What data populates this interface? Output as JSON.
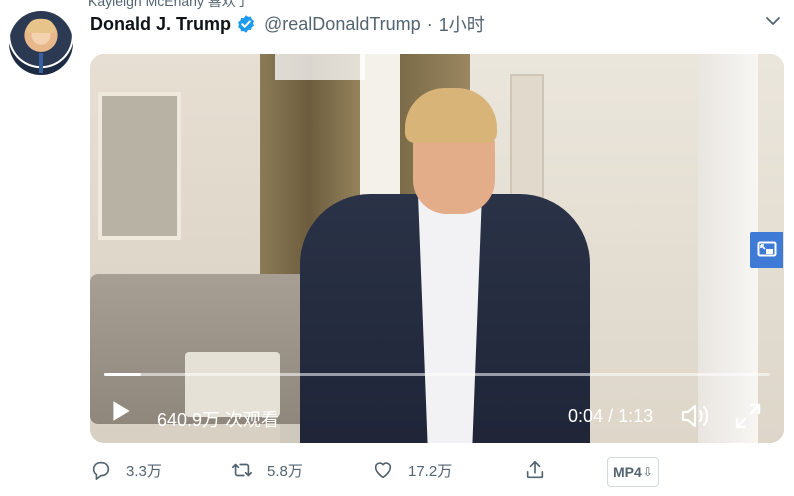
{
  "retweet_context": "Kayleigh McEnany 喜欢了",
  "tweet": {
    "author_name": "Donald J. Trump",
    "handle": "@realDonaldTrump",
    "separator": "·",
    "timestamp": "1小时",
    "verified": true
  },
  "video": {
    "views": "640.9万 次观看",
    "current_time": "0:04",
    "time_separator": "/",
    "duration": "1:13",
    "progress_fraction": 0.055
  },
  "actions": {
    "replies": "3.3万",
    "retweets": "5.8万",
    "likes": "17.2万",
    "download_label": "MP4",
    "download_glyph": "⇩"
  },
  "colors": {
    "text_primary": "#0f1419",
    "text_secondary": "#536471",
    "verified_blue": "#1d9bf0",
    "pip_blue": "#3f7ad6"
  },
  "icons": {
    "verified": "verified-badge-icon",
    "caret": "chevron-down-icon",
    "play": "play-icon",
    "volume": "volume-icon",
    "fullscreen": "fullscreen-icon",
    "pip": "picture-in-picture-icon",
    "reply": "reply-icon",
    "retweet": "retweet-icon",
    "like": "heart-icon",
    "share": "share-icon"
  }
}
